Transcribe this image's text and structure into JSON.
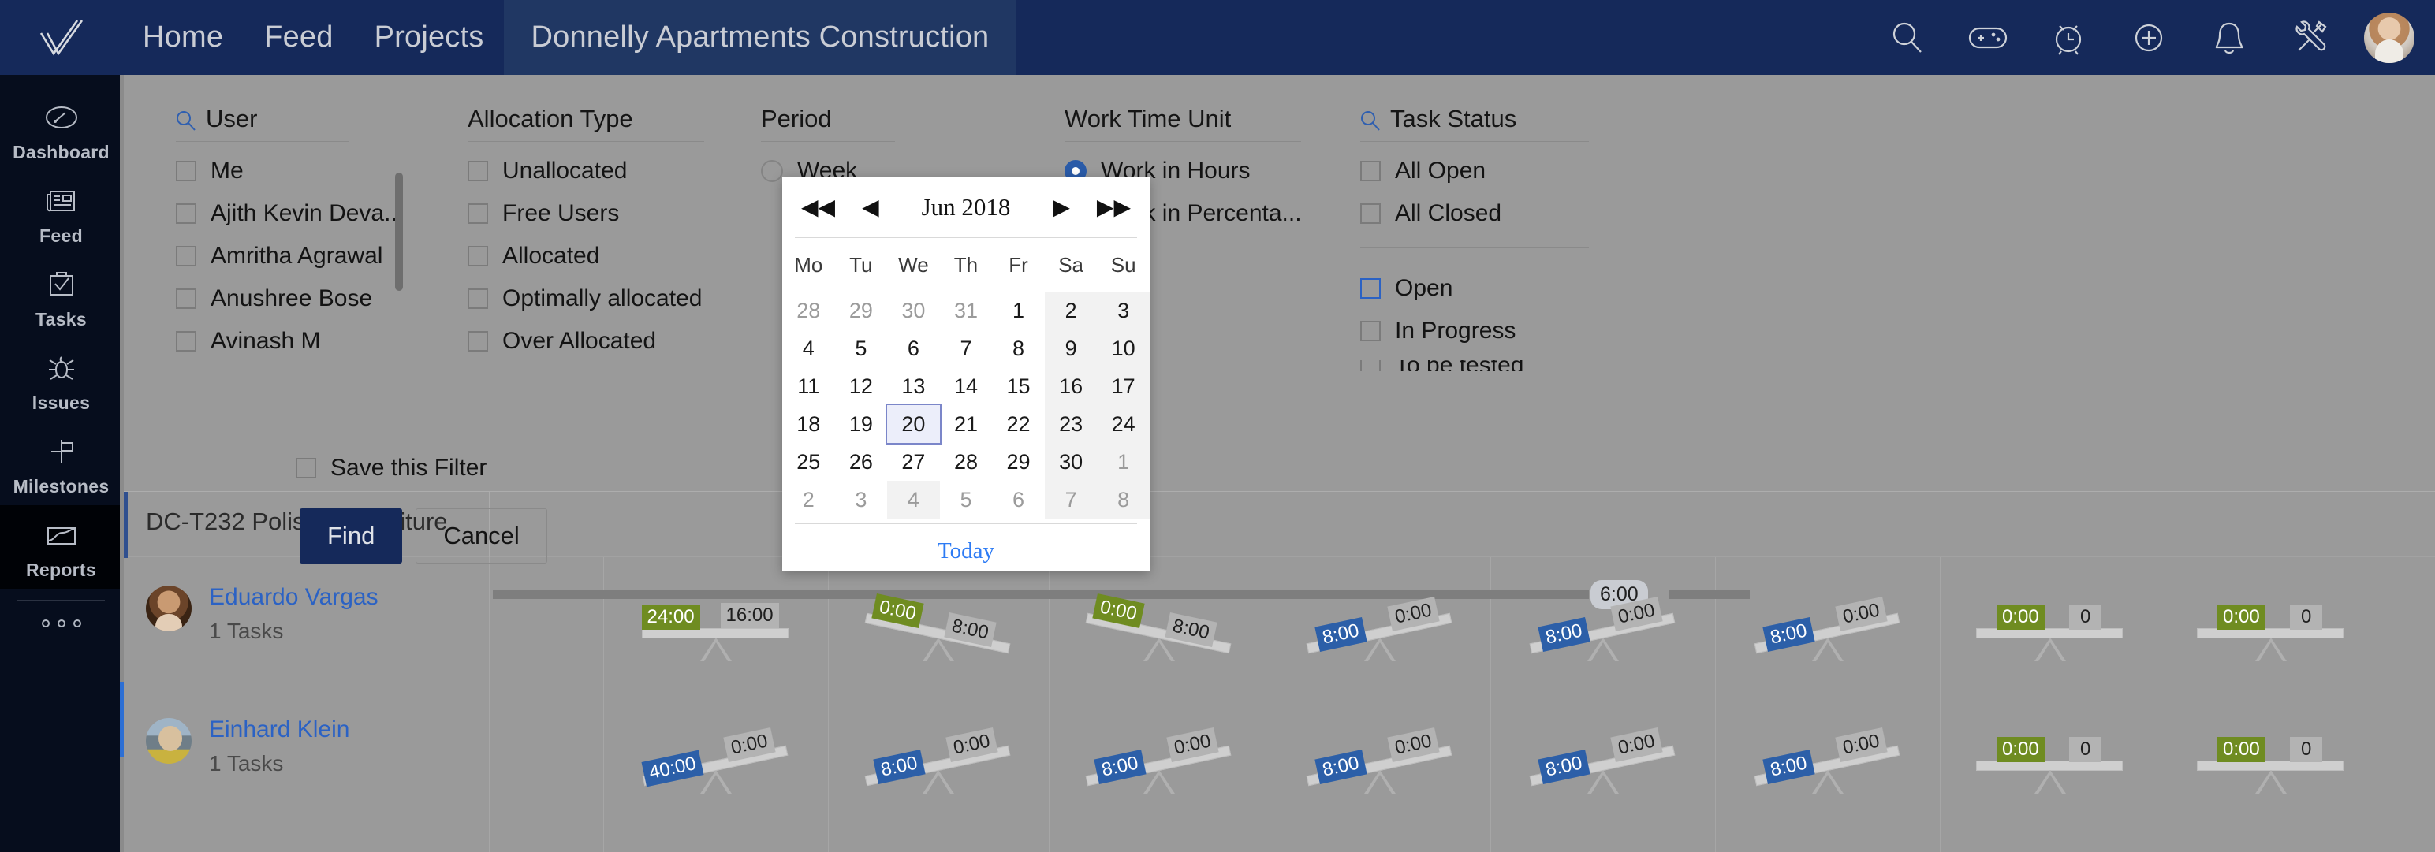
{
  "topnav": {
    "logo": "checkmark-logo",
    "links": [
      {
        "label": "Home",
        "name": "nav-home"
      },
      {
        "label": "Feed",
        "name": "nav-feed"
      },
      {
        "label": "Projects",
        "name": "nav-projects"
      }
    ],
    "project_tab": "Donnelly Apartments Construction",
    "icons": [
      "search-icon",
      "game-controller-icon",
      "timer-icon",
      "plus-circle-icon",
      "bell-icon",
      "tools-icon"
    ],
    "avatar": "user-avatar"
  },
  "sidebar": {
    "items": [
      {
        "label": "Dashboard",
        "icon": "gauge-icon"
      },
      {
        "label": "Feed",
        "icon": "newspaper-icon"
      },
      {
        "label": "Tasks",
        "icon": "clipboard-check-icon"
      },
      {
        "label": "Issues",
        "icon": "bug-icon"
      },
      {
        "label": "Milestones",
        "icon": "flag-post-icon"
      },
      {
        "label": "Reports",
        "icon": "chart-area-icon"
      }
    ],
    "more": "more-dots"
  },
  "filter": {
    "user": {
      "title": "User",
      "options": [
        "Me",
        "Ajith Kevin Deva...",
        "Amritha Agrawal",
        "Anushree Bose",
        "Avinash M"
      ]
    },
    "allocation_type": {
      "title": "Allocation Type",
      "options": [
        "Unallocated",
        "Free Users",
        "Allocated",
        "Optimally allocated",
        "Over Allocated"
      ]
    },
    "period": {
      "title": "Period",
      "options": [
        "Week"
      ]
    },
    "work_time_unit": {
      "title": "Work Time Unit",
      "options": [
        "Work in Hours",
        "Work in Percenta..."
      ],
      "selected": "Work in Hours"
    },
    "task_status": {
      "title": "Task Status",
      "group_all": [
        "All Open",
        "All Closed"
      ],
      "group_states": [
        "Open",
        "In Progress",
        "To be tested"
      ]
    },
    "save_filter_label": "Save this Filter",
    "find_label": "Find",
    "cancel_label": "Cancel"
  },
  "datepicker": {
    "title": "Jun 2018",
    "nav": {
      "first": "◀◀",
      "prev": "◀",
      "next": "▶",
      "last": "▶▶"
    },
    "weekdays": [
      "Mo",
      "Tu",
      "We",
      "Th",
      "Fr",
      "Sa",
      "Su"
    ],
    "weeks": [
      [
        {
          "d": "28",
          "mute": true
        },
        {
          "d": "29",
          "mute": true
        },
        {
          "d": "30",
          "mute": true
        },
        {
          "d": "31",
          "mute": true
        },
        {
          "d": "1"
        },
        {
          "d": "2",
          "we": true
        },
        {
          "d": "3",
          "we": true
        }
      ],
      [
        {
          "d": "4"
        },
        {
          "d": "5"
        },
        {
          "d": "6"
        },
        {
          "d": "7"
        },
        {
          "d": "8"
        },
        {
          "d": "9",
          "we": true
        },
        {
          "d": "10",
          "we": true
        }
      ],
      [
        {
          "d": "11"
        },
        {
          "d": "12"
        },
        {
          "d": "13"
        },
        {
          "d": "14"
        },
        {
          "d": "15"
        },
        {
          "d": "16",
          "we": true
        },
        {
          "d": "17",
          "we": true
        }
      ],
      [
        {
          "d": "18"
        },
        {
          "d": "19"
        },
        {
          "d": "20",
          "sel": true
        },
        {
          "d": "21"
        },
        {
          "d": "22"
        },
        {
          "d": "23",
          "we": true
        },
        {
          "d": "24",
          "we": true
        }
      ],
      [
        {
          "d": "25"
        },
        {
          "d": "26"
        },
        {
          "d": "27"
        },
        {
          "d": "28"
        },
        {
          "d": "29"
        },
        {
          "d": "30",
          "we": true
        },
        {
          "d": "1",
          "mute": true,
          "we": true
        }
      ],
      [
        {
          "d": "2",
          "mute": true
        },
        {
          "d": "3",
          "mute": true
        },
        {
          "d": "4",
          "mute": true,
          "we": true
        },
        {
          "d": "5",
          "mute": true
        },
        {
          "d": "6",
          "mute": true
        },
        {
          "d": "7",
          "mute": true,
          "we": true
        },
        {
          "d": "8",
          "mute": true,
          "we": true
        }
      ]
    ],
    "today_label": "Today",
    "selected_day": "20"
  },
  "content": {
    "task_header": "DC-T232 Polishing furniture",
    "scale_marker": "6:00",
    "rows": [
      {
        "name": "Eduardo Vargas",
        "tasks": "1 Tasks",
        "avatar": "avatar-eduardo",
        "cells": [
          {
            "left": "24:00",
            "right": "16:00",
            "left_color": "green",
            "tilt": "flat"
          },
          {
            "left": "0:00",
            "right": "8:00",
            "left_color": "green",
            "tilt": "left"
          },
          {
            "left": "0:00",
            "right": "8:00",
            "left_color": "green",
            "tilt": "left"
          },
          {
            "left": "8:00",
            "right": "0:00",
            "left_color": "blue",
            "tilt": "slight"
          },
          {
            "left": "8:00",
            "right": "0:00",
            "left_color": "blue",
            "tilt": "slight"
          },
          {
            "left": "8:00",
            "right": "0:00",
            "left_color": "blue",
            "tilt": "slight"
          },
          {
            "left": "0:00",
            "right": "0",
            "left_color": "green",
            "tilt": "flat"
          },
          {
            "left": "0:00",
            "right": "0",
            "left_color": "green",
            "tilt": "flat"
          }
        ]
      },
      {
        "name": "Einhard Klein",
        "tasks": "1 Tasks",
        "avatar": "avatar-einhard",
        "cells": [
          {
            "left": "40:00",
            "right": "0:00",
            "left_color": "blue",
            "tilt": "slight"
          },
          {
            "left": "8:00",
            "right": "0:00",
            "left_color": "blue",
            "tilt": "slight"
          },
          {
            "left": "8:00",
            "right": "0:00",
            "left_color": "blue",
            "tilt": "slight"
          },
          {
            "left": "8:00",
            "right": "0:00",
            "left_color": "blue",
            "tilt": "slight"
          },
          {
            "left": "8:00",
            "right": "0:00",
            "left_color": "blue",
            "tilt": "slight"
          },
          {
            "left": "8:00",
            "right": "0:00",
            "left_color": "blue",
            "tilt": "slight"
          },
          {
            "left": "0:00",
            "right": "0",
            "left_color": "green",
            "tilt": "flat"
          },
          {
            "left": "0:00",
            "right": "0",
            "left_color": "green",
            "tilt": "flat"
          }
        ]
      }
    ]
  },
  "colors": {
    "nav_bg": "#15295a",
    "sidebar_bg": "#060d1d",
    "overlay_bg": "#9a9a9a",
    "accent_blue": "#2b62c4",
    "tag_green": "#6f8c21",
    "tag_blue": "#2c5fa8",
    "link_blue": "#2d7bf4"
  }
}
